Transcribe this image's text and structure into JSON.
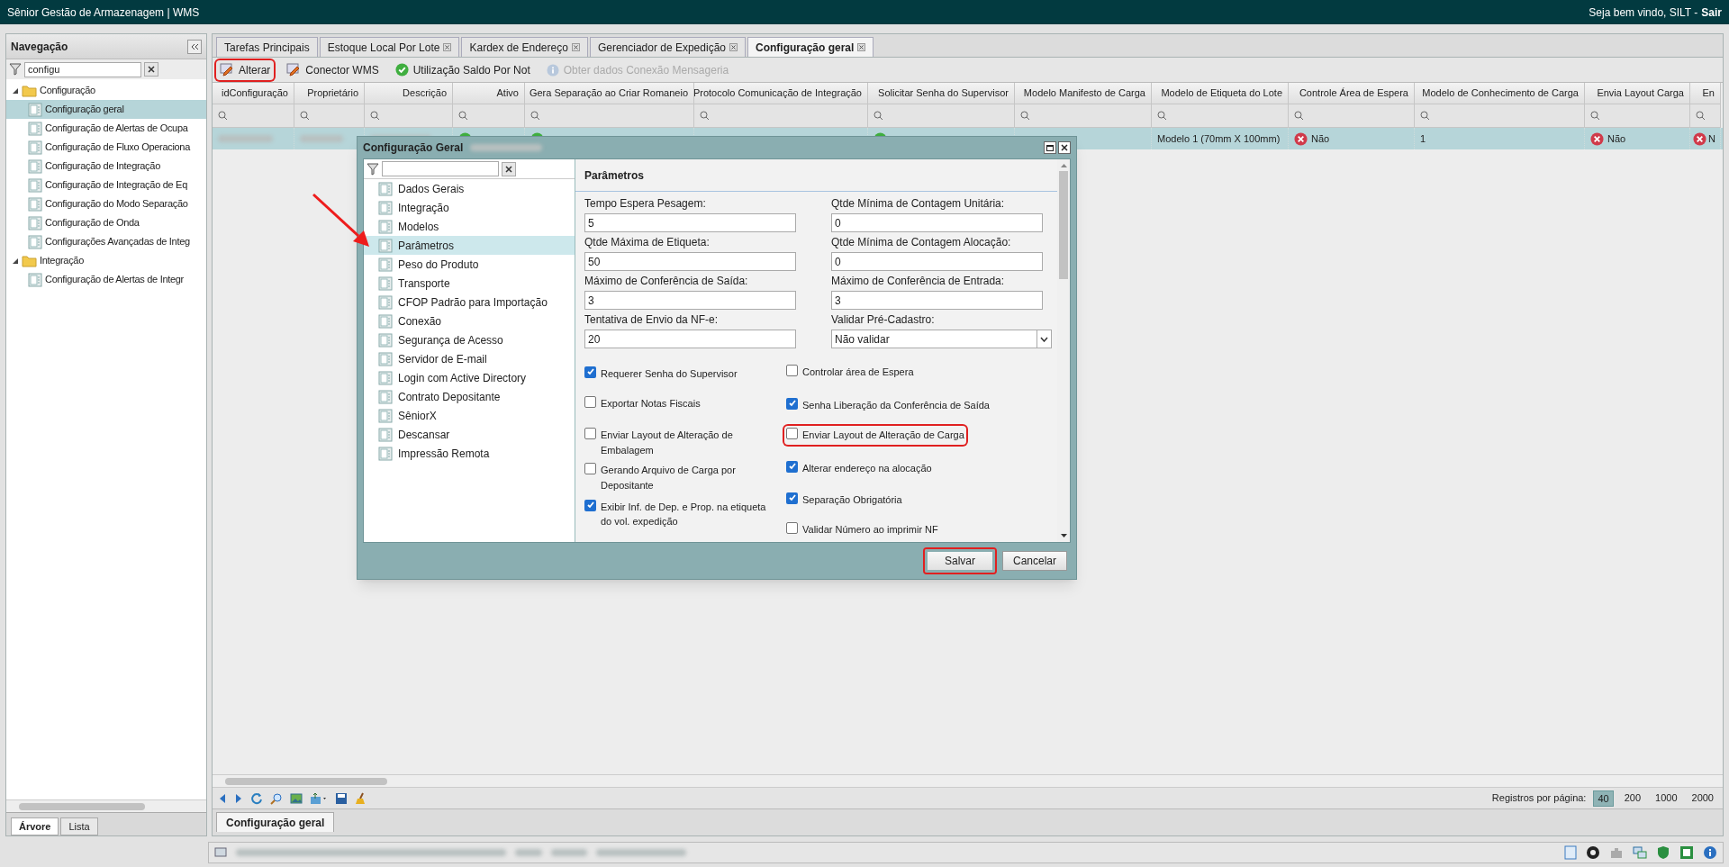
{
  "app": {
    "title": "Sênior Gestão de Armazenagem | WMS",
    "welcome": "Seja bem vindo, SILT -",
    "logout": "Sair"
  },
  "sidebar": {
    "title": "Navegação",
    "filter": {
      "value": "configu"
    },
    "tree": [
      {
        "label": "Configuração",
        "expanded": true,
        "selected": false,
        "children": [
          {
            "label": "Configuração geral",
            "selected": true
          },
          {
            "label": "Configuração de Alertas de Ocupa",
            "selected": false
          },
          {
            "label": "Configuração de Fluxo Operaciona",
            "selected": false
          },
          {
            "label": "Configuração de Integração",
            "selected": false
          },
          {
            "label": "Configuração de Integração de Eq",
            "selected": false
          },
          {
            "label": "Configuração do Modo Separação",
            "selected": false
          },
          {
            "label": "Configuração de Onda",
            "selected": false
          },
          {
            "label": "Configurações Avançadas de Integ",
            "selected": false
          }
        ]
      },
      {
        "label": "Integração",
        "expanded": true,
        "selected": false,
        "children": [
          {
            "label": "Configuração de Alertas de Integr",
            "selected": false
          }
        ]
      }
    ],
    "tabs": [
      {
        "label": "Árvore",
        "selected": true
      },
      {
        "label": "Lista",
        "selected": false
      }
    ]
  },
  "tabs": [
    {
      "label": "Tarefas Principais",
      "selected": false,
      "closable": false
    },
    {
      "label": "Estoque Local Por Lote",
      "selected": false,
      "closable": true
    },
    {
      "label": "Kardex de Endereço",
      "selected": false,
      "closable": true
    },
    {
      "label": "Gerenciador de Expedição",
      "selected": false,
      "closable": true
    },
    {
      "label": "Configuração geral",
      "selected": true,
      "closable": true
    }
  ],
  "toolbar": [
    {
      "kind": "edit",
      "label": "Alterar",
      "disabled": false,
      "highlighted": true
    },
    {
      "kind": "edit",
      "label": "Conector WMS",
      "disabled": false,
      "highlighted": false
    },
    {
      "kind": "check",
      "label": "Utilização Saldo Por Not",
      "disabled": false,
      "highlighted": false
    },
    {
      "kind": "info",
      "label": "Obter dados Conexão Mensageria",
      "disabled": true,
      "highlighted": false
    }
  ],
  "table": {
    "columns": [
      "idConfiguração",
      "Proprietário",
      "Descrição",
      "Ativo",
      "Gera Separação ao Criar Romaneio",
      "Protocolo Comunicação de Integração",
      "Solicitar Senha do Supervisor",
      "Modelo Manifesto de Carga",
      "Modelo de Etiqueta do Lote",
      "Controle Área de Espera",
      "Modelo de Conhecimento de Carga",
      "Envia Layout Carga",
      "En"
    ],
    "rows": [
      {
        "selected": true,
        "cells": [
          {
            "kind": "hidden"
          },
          {
            "kind": "hidden"
          },
          {
            "kind": "hidden"
          },
          {
            "kind": "yes"
          },
          {
            "kind": "yes"
          },
          {
            "kind": "empty"
          },
          {
            "kind": "yes"
          },
          {
            "kind": "empty"
          },
          {
            "kind": "text",
            "text": "Modelo 1 (70mm X 100mm)"
          },
          {
            "kind": "no",
            "text": "Não"
          },
          {
            "kind": "text",
            "text": "1"
          },
          {
            "kind": "no",
            "text": "Não"
          },
          {
            "kind": "no",
            "text": "N"
          }
        ]
      }
    ]
  },
  "pager": {
    "label": "Registros por página:",
    "sizes": [
      {
        "label": "40",
        "selected": true
      },
      {
        "label": "200",
        "selected": false
      },
      {
        "label": "1000",
        "selected": false
      },
      {
        "label": "2000",
        "selected": false
      }
    ]
  },
  "bottom_tab": {
    "label": "Configuração geral"
  },
  "dialog": {
    "title": "Configuração Geral",
    "nav": [
      {
        "label": "Dados Gerais",
        "selected": false
      },
      {
        "label": "Integração",
        "selected": false
      },
      {
        "label": "Modelos",
        "selected": false
      },
      {
        "label": "Parâmetros",
        "selected": true
      },
      {
        "label": "Peso do Produto",
        "selected": false
      },
      {
        "label": "Transporte",
        "selected": false
      },
      {
        "label": "CFOP Padrão para Importação",
        "selected": false
      },
      {
        "label": "Conexão",
        "selected": false
      },
      {
        "label": "Segurança de Acesso",
        "selected": false
      },
      {
        "label": "Servidor de E-mail",
        "selected": false
      },
      {
        "label": "Login com Active Directory",
        "selected": false
      },
      {
        "label": "Contrato Depositante",
        "selected": false
      },
      {
        "label": "SêniorX",
        "selected": false
      },
      {
        "label": "Descansar",
        "selected": false
      },
      {
        "label": "Impressão Remota",
        "selected": false
      }
    ],
    "section": "Parâmetros",
    "fields": [
      {
        "label": "Tempo Espera Pesagem:",
        "value": "5",
        "kind": "text"
      },
      {
        "label": "Qtde Mínima de Contagem Unitária:",
        "value": "0",
        "kind": "text"
      },
      {
        "label": "Qtde Máxima de Etiqueta:",
        "value": "50",
        "kind": "text"
      },
      {
        "label": "Qtde Mínima de Contagem Alocação:",
        "value": "0",
        "kind": "text"
      },
      {
        "label": "Máximo de Conferência de Saída:",
        "value": "3",
        "kind": "text"
      },
      {
        "label": "Máximo de Conferência de Entrada:",
        "value": "3",
        "kind": "text"
      },
      {
        "label": "Tentativa de Envio da NF-e:",
        "value": "20",
        "kind": "text"
      },
      {
        "label": "Validar Pré-Cadastro:",
        "value": "Não validar",
        "kind": "select"
      }
    ],
    "checks_left": [
      {
        "label": "Requerer Senha do Supervisor",
        "checked": true,
        "highlighted": false
      },
      {
        "label": "Exportar Notas Fiscais",
        "checked": false,
        "highlighted": false
      },
      {
        "label": "Enviar Layout de Alteração de Embalagem",
        "checked": false,
        "highlighted": false
      },
      {
        "label": "Gerando Arquivo de Carga por Depositante",
        "checked": false,
        "highlighted": false
      },
      {
        "label": "Exibir Inf. de Dep. e Prop. na etiqueta do vol. expedição",
        "checked": true,
        "highlighted": false
      }
    ],
    "checks_right": [
      {
        "label": "Controlar área de Espera",
        "checked": false,
        "highlighted": false
      },
      {
        "label": "Senha Liberação da Conferência de Saída",
        "checked": true,
        "highlighted": false
      },
      {
        "label": "Enviar Layout de Alteração de Carga",
        "checked": false,
        "highlighted": true
      },
      {
        "label": "Alterar endereço na alocação",
        "checked": true,
        "highlighted": false
      },
      {
        "label": "Separação Obrigatória",
        "checked": true,
        "highlighted": false
      },
      {
        "label": "Validar Número ao imprimir NF",
        "checked": false,
        "highlighted": false
      }
    ],
    "buttons": [
      {
        "label": "Salvar",
        "highlighted": true
      },
      {
        "label": "Cancelar",
        "highlighted": false
      }
    ]
  }
}
